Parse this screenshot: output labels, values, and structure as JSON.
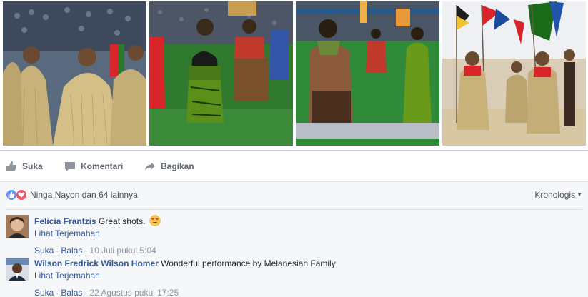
{
  "actions": {
    "like_label": "Suka",
    "comment_label": "Komentari",
    "share_label": "Bagikan"
  },
  "reactions": {
    "types": [
      "like-icon",
      "love-icon"
    ],
    "summary": "Ninga Nayon dan 64 lainnya"
  },
  "sort": {
    "label": "Kronologis"
  },
  "comments": [
    {
      "author": "Felicia Frantzis",
      "text": "Great shots.",
      "emoji": "heart-eyes-emoji",
      "translate": "Lihat Terjemahan",
      "like": "Suka",
      "reply": "Balas",
      "time": "10 Juli pukul 5:04"
    },
    {
      "author": "Wilson Fredrick Wilson Homer",
      "text": "Wonderful performance by Melanesian Family",
      "translate": "Lihat Terjemahan",
      "like": "Suka",
      "reply": "Balas",
      "time": "22 Agustus pukul 17:25"
    }
  ],
  "colors": {
    "link": "#365899",
    "muted": "#90949c",
    "action": "#606770",
    "like_blue": "#5890ff",
    "love_red": "#f25268"
  }
}
